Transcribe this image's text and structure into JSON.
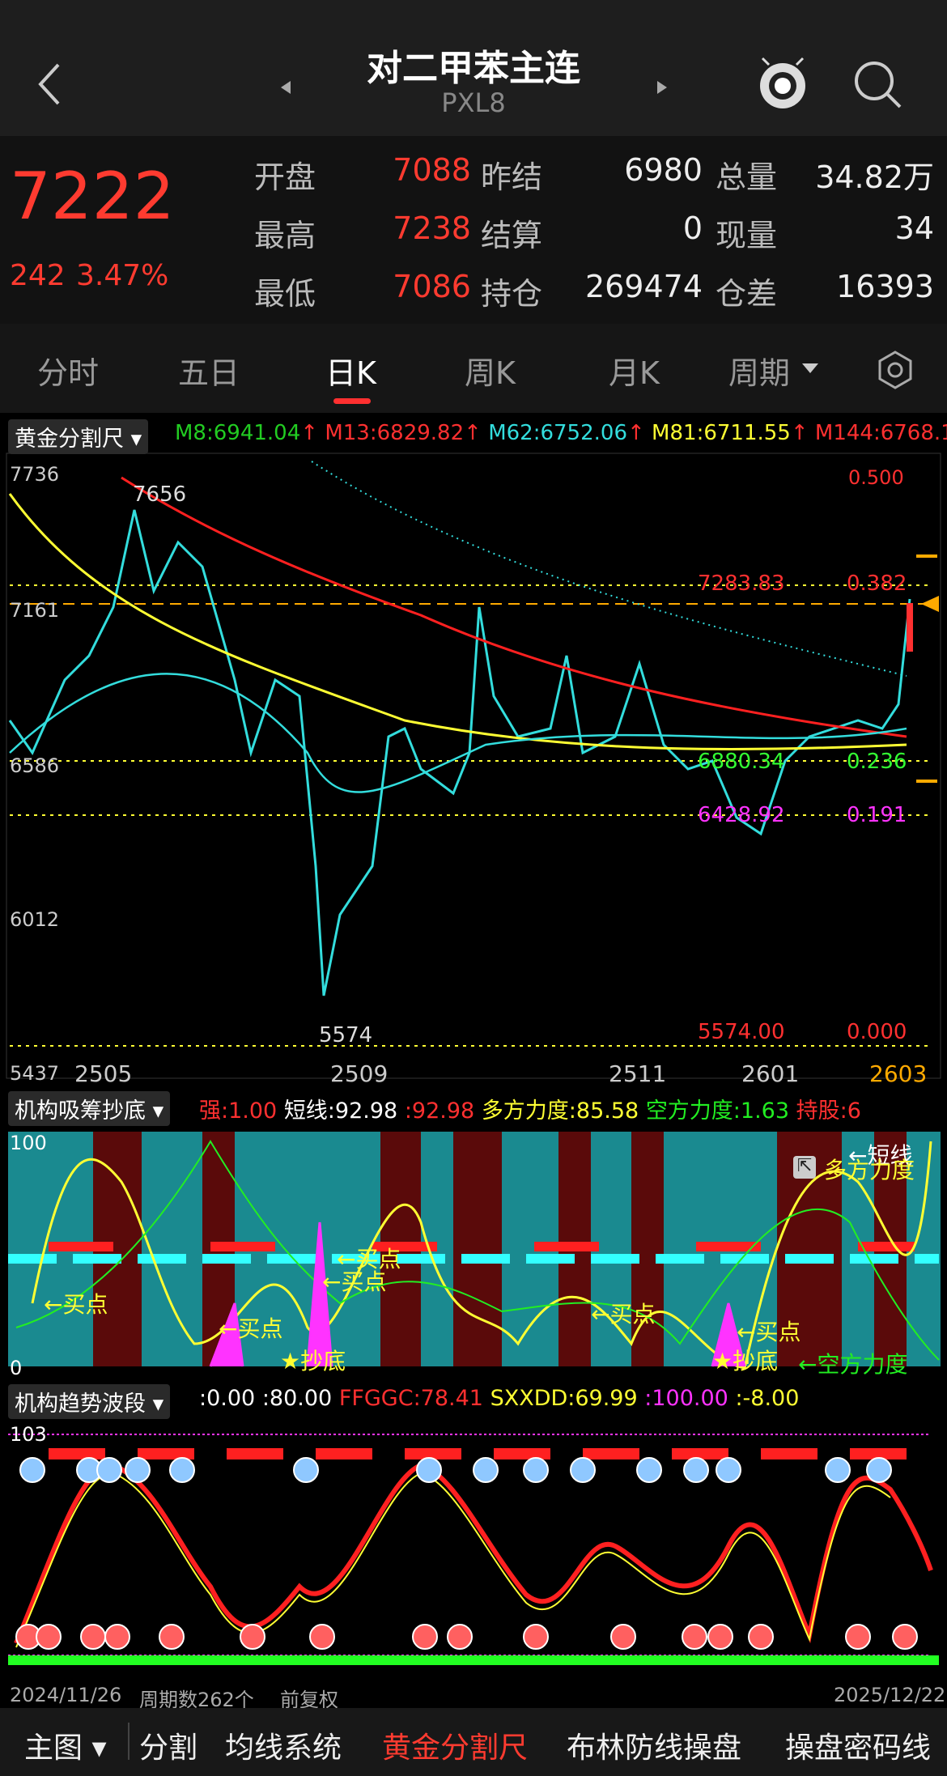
{
  "header": {
    "title": "对二甲苯主连",
    "code": "PXL8"
  },
  "quote": {
    "price": "7222",
    "change": "242",
    "change_pct": "3.47%",
    "rows": [
      [
        {
          "label": "开盘",
          "value": "7088",
          "color": "red"
        },
        {
          "label": "昨结",
          "value": "6980",
          "color": "white"
        },
        {
          "label": "总量",
          "value": "34.82万",
          "color": "white"
        }
      ],
      [
        {
          "label": "最高",
          "value": "7238",
          "color": "red"
        },
        {
          "label": "结算",
          "value": "0",
          "color": "white"
        },
        {
          "label": "现量",
          "value": "34",
          "color": "white"
        }
      ],
      [
        {
          "label": "最低",
          "value": "7086",
          "color": "red"
        },
        {
          "label": "持仓",
          "value": "269474",
          "color": "white"
        },
        {
          "label": "仓差",
          "value": "16393",
          "color": "white"
        }
      ]
    ]
  },
  "tabs": {
    "items": [
      "分时",
      "五日",
      "日K",
      "周K",
      "月K",
      "周期"
    ],
    "active": "日K"
  },
  "main_chart": {
    "indicator": "黄金分割尺",
    "ma": [
      {
        "label": "M8:6941.04",
        "color": "#22cc22"
      },
      {
        "label": "M13:6829.82",
        "color": "#ff3030"
      },
      {
        "label": "M62:6752.06",
        "color": "#33dddd"
      },
      {
        "label": "M81:6711.55",
        "color": "#ffff33"
      },
      {
        "label": "M144:6768.1",
        "color": "#ff3030"
      }
    ],
    "y_labels": [
      "7736",
      "7161",
      "6586",
      "6012",
      "5437"
    ],
    "x_labels": [
      "2505",
      "2509",
      "2511",
      "2601",
      "2603"
    ],
    "annot": {
      "high": "7656",
      "low": "5574",
      "l382": "7283.83",
      "r382": "0.382",
      "l236": "6880.34",
      "r236": "0.236",
      "l191": "6428.92",
      "r191": "0.191",
      "l000": "5574.00",
      "r000": "0.000",
      "top_r": "0.500"
    }
  },
  "panel1": {
    "indicator": "机构吸筹抄底",
    "labels": [
      {
        "t": "强:1.00",
        "c": "#ff3030"
      },
      {
        "t": "短线:92.98",
        "c": "#ffffff"
      },
      {
        "t": ":92.98",
        "c": "#ff3030"
      },
      {
        "t": "多方力度:85.58",
        "c": "#ffff33"
      },
      {
        "t": "空方力度:1.63",
        "c": "#22ee22"
      },
      {
        "t": "持股:6",
        "c": "#ff3030"
      }
    ],
    "scale_top": "100",
    "scale_bottom": "0",
    "notes": {
      "buy": "买点",
      "bottom": "抄底",
      "short": "短线",
      "long_power": "多方力度",
      "short_power": "←空方力度"
    }
  },
  "panel2": {
    "indicator": "机构趋势波段",
    "labels": [
      {
        "t": ":0.00",
        "c": "#ffffff"
      },
      {
        "t": ":80.00",
        "c": "#ffffff"
      },
      {
        "t": "FFGGC:78.41",
        "c": "#ff3030"
      },
      {
        "t": "SXXDD:69.99",
        "c": "#ffff33"
      },
      {
        "t": ":100.00",
        "c": "#ff33ff"
      },
      {
        "t": ":-8.00",
        "c": "#ffff33"
      }
    ],
    "scale_top": "103"
  },
  "bottom_info": {
    "start": "2024/11/26",
    "count": "周期数262个",
    "adj": "前复权",
    "end": "2025/12/22"
  },
  "footer": {
    "main": "主图",
    "items": [
      "分割",
      "均线系统",
      "黄金分割尺",
      "布林防线操盘",
      "操盘密码线"
    ],
    "active": "黄金分割尺"
  }
}
